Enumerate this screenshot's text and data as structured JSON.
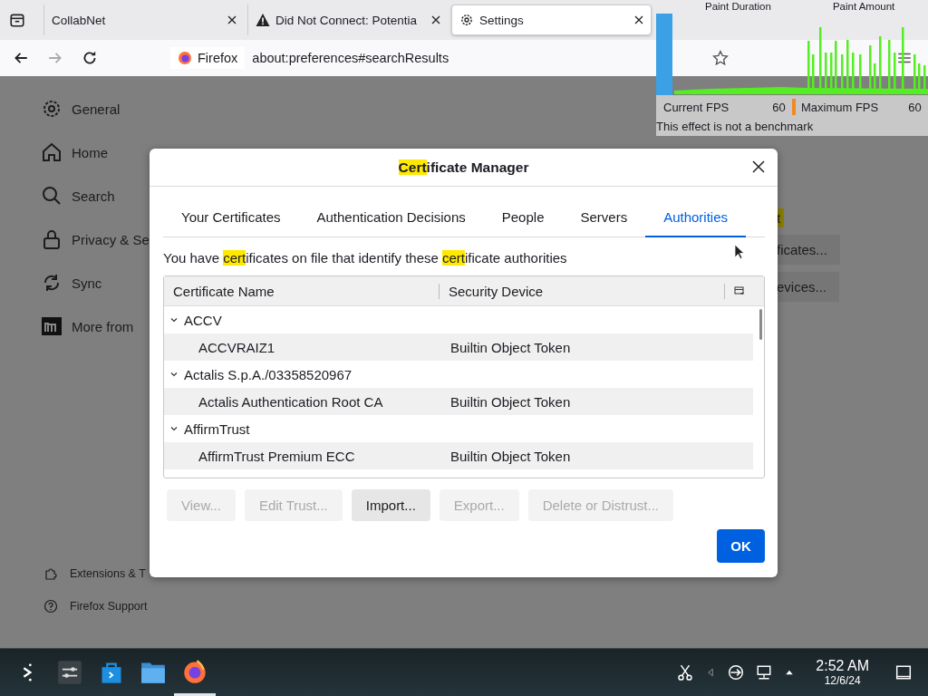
{
  "browser": {
    "tabs": [
      {
        "title": "CollabNet",
        "selected": false
      },
      {
        "title": "Did Not Connect: Potentia",
        "selected": false
      },
      {
        "title": "Settings",
        "selected": true
      }
    ],
    "identity_label": "Firefox",
    "url": "about:preferences#searchResults"
  },
  "perf_overlay": {
    "labels": [
      "Paint Duration",
      "Paint Amount"
    ],
    "current_fps_label": "Current FPS",
    "current_fps": "60",
    "max_fps_label": "Maximum FPS",
    "max_fps": "60",
    "note": "This effect is not a benchmark"
  },
  "sidebar": {
    "items": [
      {
        "label": "General"
      },
      {
        "label": "Home"
      },
      {
        "label": "Search"
      },
      {
        "label": "Privacy & Se"
      },
      {
        "label": "Sync"
      },
      {
        "label": "More from"
      }
    ],
    "footer_links": [
      {
        "label": "Extensions & T"
      },
      {
        "label": "Firefox Support"
      }
    ]
  },
  "background_texts": [
    {
      "text": "t",
      "highlighted": true
    },
    {
      "text": "ficates...",
      "highlighted": false
    },
    {
      "text": "evices...",
      "highlighted": false
    }
  ],
  "dialog": {
    "title": [
      {
        "text": "Cert",
        "highlighted": true
      },
      {
        "text": "ificate Manager",
        "highlighted": false
      }
    ],
    "tabs": [
      {
        "label": "Your Certificates",
        "selected": false
      },
      {
        "label": "Authentication Decisions",
        "selected": false
      },
      {
        "label": "People",
        "selected": false
      },
      {
        "label": "Servers",
        "selected": false
      },
      {
        "label": "Authorities",
        "selected": true
      }
    ],
    "description": [
      {
        "text": "You have ",
        "highlighted": false
      },
      {
        "text": "cert",
        "highlighted": true
      },
      {
        "text": "ificates on file that identify these ",
        "highlighted": false
      },
      {
        "text": "cert",
        "highlighted": true
      },
      {
        "text": "ificate authorities",
        "highlighted": false
      }
    ],
    "table": {
      "columns": [
        "Certificate Name",
        "Security Device"
      ],
      "rows": [
        {
          "name": "ACCV",
          "expanded": true,
          "children": [
            {
              "name": "ACCVRAIZ1",
              "device": "Builtin Object Token"
            }
          ]
        },
        {
          "name": "Actalis S.p.A./03358520967",
          "expanded": true,
          "children": [
            {
              "name": "Actalis Authentication Root CA",
              "device": "Builtin Object Token"
            }
          ]
        },
        {
          "name": "AffirmTrust",
          "expanded": true,
          "children": [
            {
              "name": "AffirmTrust Premium ECC",
              "device": "Builtin Object Token"
            }
          ]
        }
      ]
    },
    "buttons": [
      {
        "label": "View...",
        "disabled": true
      },
      {
        "label": "Edit Trust...",
        "disabled": true
      },
      {
        "label": "Import...",
        "disabled": false
      },
      {
        "label": "Export...",
        "disabled": true
      },
      {
        "label": "Delete or Distrust...",
        "disabled": true
      }
    ],
    "ok_button": "OK"
  },
  "taskbar": {
    "apps": [
      {
        "active": false
      },
      {
        "active": false
      },
      {
        "active": false
      },
      {
        "active": false
      },
      {
        "active": true
      }
    ],
    "time": "2:52 AM",
    "date": "12/6/24"
  }
}
